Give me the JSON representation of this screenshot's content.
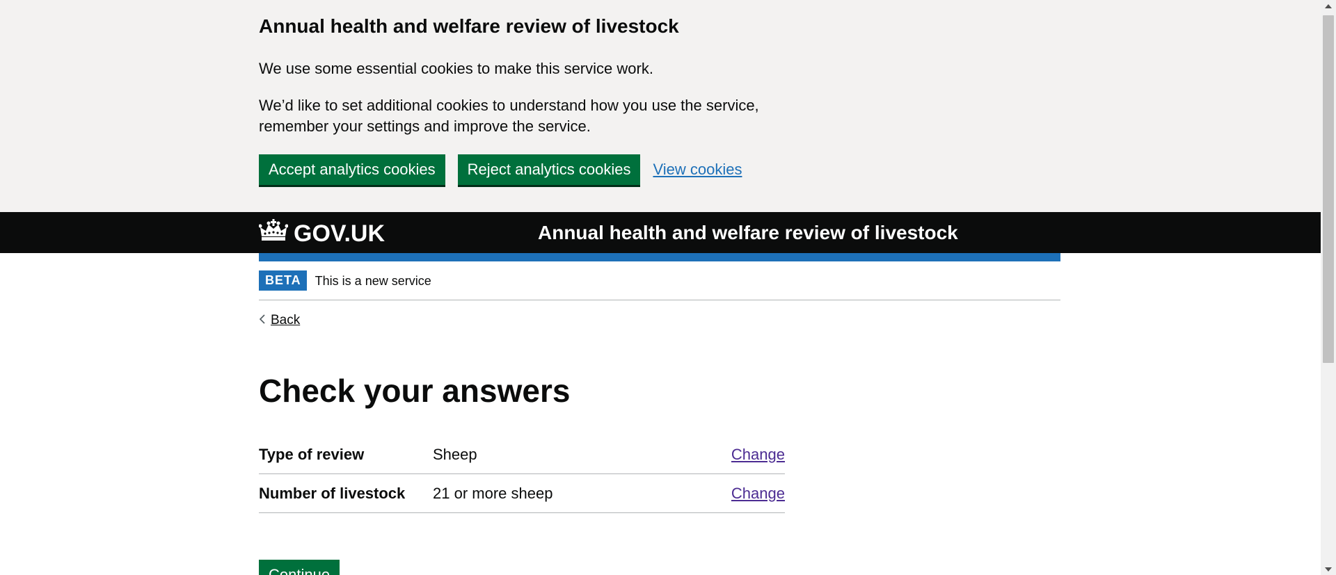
{
  "cookie_banner": {
    "title": "Annual health and welfare review of livestock",
    "paragraph1": "We use some essential cookies to make this service work.",
    "paragraph2": "We’d like to set additional cookies to understand how you use the service, remember your settings and improve the service.",
    "accept_label": "Accept analytics cookies",
    "reject_label": "Reject analytics cookies",
    "view_label": "View cookies"
  },
  "header": {
    "logo_text": "GOV.UK",
    "service_name": "Annual health and welfare review of livestock"
  },
  "phase_banner": {
    "tag": "BETA",
    "text": "This is a new service"
  },
  "back_link": "Back",
  "page_title": "Check your answers",
  "summary": [
    {
      "key": "Type of review",
      "value": "Sheep",
      "action": "Change"
    },
    {
      "key": "Number of livestock",
      "value": "21 or more sheep",
      "action": "Change"
    }
  ],
  "continue_label": "Continue",
  "colors": {
    "green": "#00703c",
    "blue": "#1d70b8",
    "black": "#0b0c0c",
    "grey_bg": "#f3f2f1",
    "visited": "#4c2c92"
  }
}
